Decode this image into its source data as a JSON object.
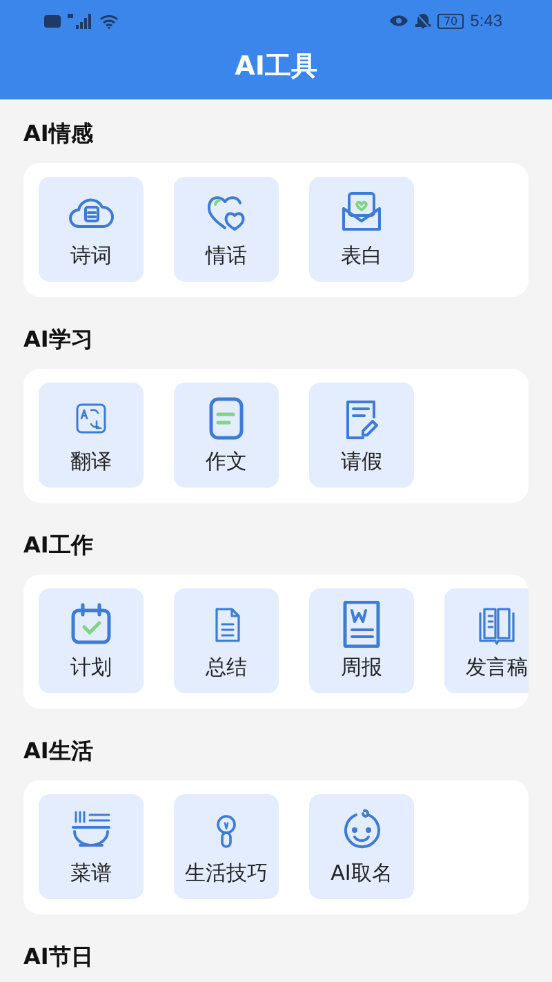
{
  "status_bar": {
    "battery": "70",
    "time": "5:43"
  },
  "header": {
    "title": "AI工具"
  },
  "sections": [
    {
      "title": "AI情感",
      "items": [
        {
          "label": "诗词"
        },
        {
          "label": "情话"
        },
        {
          "label": "表白"
        }
      ]
    },
    {
      "title": "AI学习",
      "items": [
        {
          "label": "翻译"
        },
        {
          "label": "作文"
        },
        {
          "label": "请假"
        }
      ]
    },
    {
      "title": "AI工作",
      "items": [
        {
          "label": "计划"
        },
        {
          "label": "总结"
        },
        {
          "label": "周报"
        },
        {
          "label": "发言稿"
        }
      ]
    },
    {
      "title": "AI生活",
      "items": [
        {
          "label": "菜谱"
        },
        {
          "label": "生活技巧"
        },
        {
          "label": "AI取名"
        }
      ]
    },
    {
      "title": "AI节日"
    }
  ]
}
